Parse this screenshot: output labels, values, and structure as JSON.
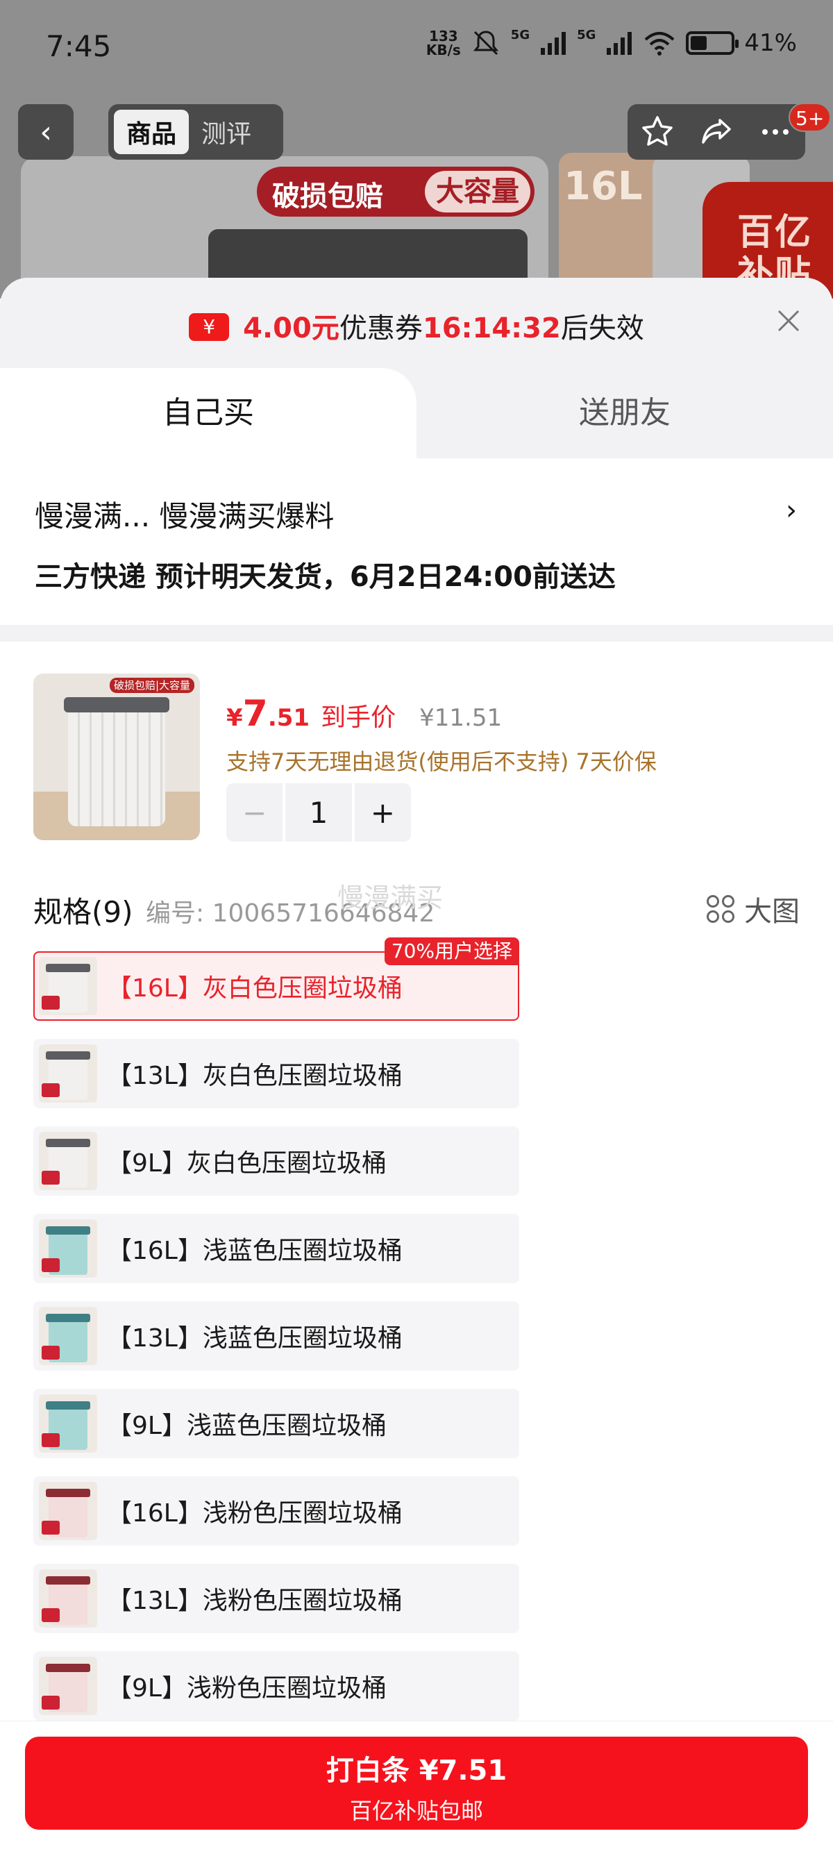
{
  "status_bar": {
    "time": "7:45",
    "net_speed": "133",
    "net_unit": "KB/s",
    "signal1": "5G",
    "signal2": "5G",
    "battery_level": 0.41,
    "battery": "41%"
  },
  "nav": {
    "back_glyph": "‹",
    "tabs": [
      "商品",
      "测评"
    ],
    "message_badge": "5+"
  },
  "banner": {
    "pill_text": "破损包赔",
    "pill_highlight": "大容量",
    "size": "16L",
    "subsidy_line1": "百亿",
    "subsidy_line2": "补贴"
  },
  "coupon": {
    "icon_glyph": "¥",
    "amount": "4.00元",
    "text_mid": "优惠券",
    "countdown": "16:14:32",
    "text_end": "后失效"
  },
  "buy_tabs": [
    "自己买",
    "送朋友"
  ],
  "address": {
    "line": "慢漫满...  慢漫满买爆料",
    "chevron": "›",
    "delivery": "三方快递 预计明天发货，6月2日24:00前送达"
  },
  "product": {
    "thumb_tag": "破损包赔|大容量",
    "price_symbol": "¥",
    "price_int": "7",
    "price_dec": ".51",
    "price_label": "到手价",
    "original_price": "¥11.51",
    "service": "支持7天无理由退货(使用后不支持) 7天价保",
    "quantity": "1",
    "minus": "−",
    "plus": "+"
  },
  "specs": {
    "title": "规格(9)",
    "code": "编号: 10065716646842",
    "watermark": "慢漫满买",
    "big_view": "大图",
    "badge": "70%用户选择",
    "items": [
      {
        "label": "【16L】灰白色压圈垃圾桶",
        "color": "#f1f0ee",
        "lid": "#5b5d61"
      },
      {
        "label": "【13L】灰白色压圈垃圾桶",
        "color": "#f1f0ee",
        "lid": "#5b5d61"
      },
      {
        "label": "【9L】灰白色压圈垃圾桶",
        "color": "#f1f0ee",
        "lid": "#5b5d61"
      },
      {
        "label": "【16L】浅蓝色压圈垃圾桶",
        "color": "#a8d8d6",
        "lid": "#3f7f86"
      },
      {
        "label": "【13L】浅蓝色压圈垃圾桶",
        "color": "#a8d8d6",
        "lid": "#3f7f86"
      },
      {
        "label": "【9L】浅蓝色压圈垃圾桶",
        "color": "#a8d8d6",
        "lid": "#3f7f86"
      },
      {
        "label": "【16L】浅粉色压圈垃圾桶",
        "color": "#f3dcdc",
        "lid": "#8c2c35"
      },
      {
        "label": "【13L】浅粉色压圈垃圾桶",
        "color": "#f3dcdc",
        "lid": "#8c2c35"
      },
      {
        "label": "【9L】浅粉色压圈垃圾桶",
        "color": "#f3dcdc",
        "lid": "#8c2c35"
      }
    ]
  },
  "cta": {
    "line1": "打白条 ¥7.51",
    "line2": "百亿补贴包邮"
  },
  "colors": {
    "accent": "#e8232b",
    "button": "#f5121c",
    "service_text": "#a8732b"
  }
}
